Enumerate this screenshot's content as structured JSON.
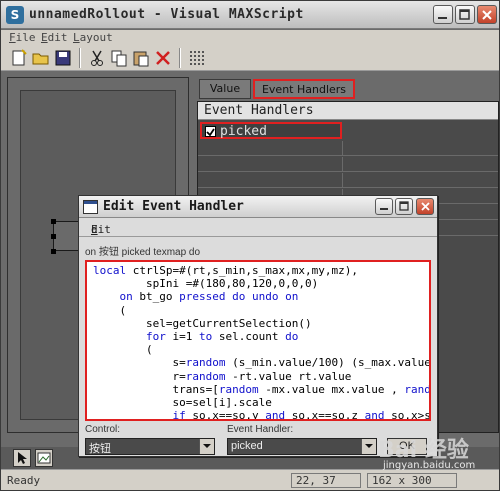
{
  "window": {
    "title": "unnamedRollout - Visual MAXScript",
    "minimize_icon": "minimize-icon",
    "maximize_icon": "maximize-icon",
    "close_icon": "close-icon"
  },
  "menu": [
    {
      "key": "F",
      "rest": "ile"
    },
    {
      "key": "E",
      "rest": "dit"
    },
    {
      "key": "L",
      "rest": "ayout"
    }
  ],
  "toolbar": {
    "icons": [
      "new-icon",
      "open-icon",
      "save-icon",
      "cut-icon",
      "copy-icon",
      "paste-icon",
      "delete-icon",
      "grid-icon"
    ]
  },
  "rollout": {
    "button_label": "按钮"
  },
  "tabs": {
    "value": "Value",
    "event_handlers": "Event Handlers"
  },
  "event_grid": {
    "header": "Event Handlers",
    "rows": [
      {
        "label": "picked",
        "checked": true
      }
    ]
  },
  "dialog": {
    "title": "Edit Event Handler",
    "menu_key": "E",
    "menu_rest": "dit",
    "caption": "on 按钮 picked texmap do",
    "code": [
      "local ctrlSp=#(rt,s_min,s_max,mx,my,mz),",
      "        spIni =#(180,80,120,0,0,0)",
      "    on bt_go pressed do undo on",
      "    (",
      "        sel=getCurrentSelection()",
      "        for i=1 to sel.count do",
      "        (",
      "            s=random (s_min.value/100) (s_max.value/10",
      "            r=random -rt.value rt.value",
      "            trans=[random -mx.value mx.value , random",
      "            so=sel[i].scale",
      "            if so.x==so.y and so.x==so.z and so.x>s mi"
    ],
    "control_label": "Control:",
    "control_value": "按钮",
    "event_label": "Event Handler:",
    "event_value": "picked",
    "ok_label": "OK"
  },
  "status": {
    "text": "Ready",
    "coords": "22, 37",
    "size": "162 x 300"
  },
  "watermark": {
    "brand": "Bai 经验",
    "url": "jingyan.baidu.com"
  }
}
